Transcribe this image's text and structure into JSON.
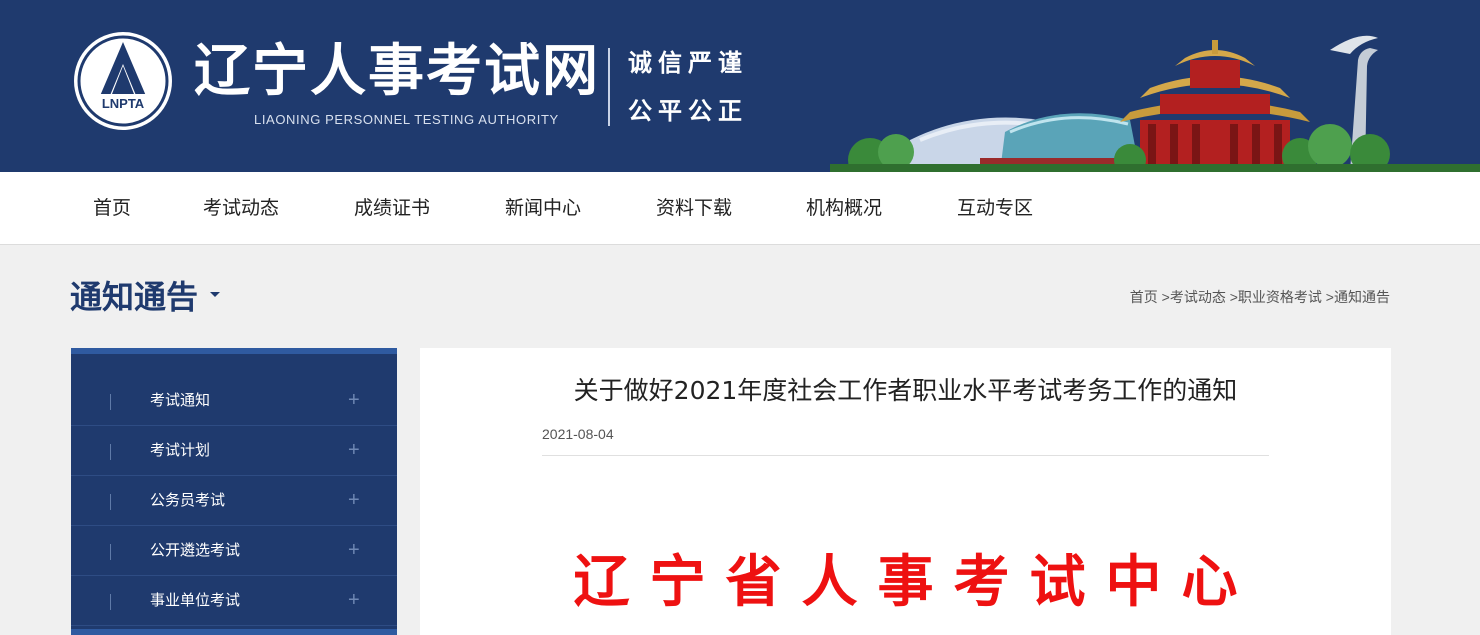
{
  "header": {
    "logo_badge_text": "LNPTA",
    "site_title": "辽宁人事考试网",
    "site_subtitle": "LIAONING PERSONNEL TESTING AUTHORITY",
    "motto_line1": "诚信严谨",
    "motto_line2": "公平公正"
  },
  "nav": {
    "items": [
      "首页",
      "考试动态",
      "成绩证书",
      "新闻中心",
      "资料下载",
      "机构概况",
      "互动专区"
    ]
  },
  "section": {
    "title": "通知通告",
    "breadcrumb": [
      "首页",
      "考试动态",
      "职业资格考试",
      "通知通告"
    ],
    "breadcrumb_sep": " >"
  },
  "sidebar": {
    "items": [
      {
        "label": "考试通知",
        "icon": "plus-icon"
      },
      {
        "label": "考试计划",
        "icon": "plus-icon"
      },
      {
        "label": "公务员考试",
        "icon": "plus-icon"
      },
      {
        "label": "公开遴选考试",
        "icon": "plus-icon"
      },
      {
        "label": "事业单位考试",
        "icon": "plus-icon"
      }
    ]
  },
  "article": {
    "title": "关于做好2021年度社会工作者职业水平考试考务工作的通知",
    "date": "2021-08-04",
    "red_heading": "辽宁省人事考试中心"
  },
  "colors": {
    "brand_navy": "#1f3a6e",
    "accent_blue": "#2f5aa0",
    "red_heading": "#ee1111"
  }
}
